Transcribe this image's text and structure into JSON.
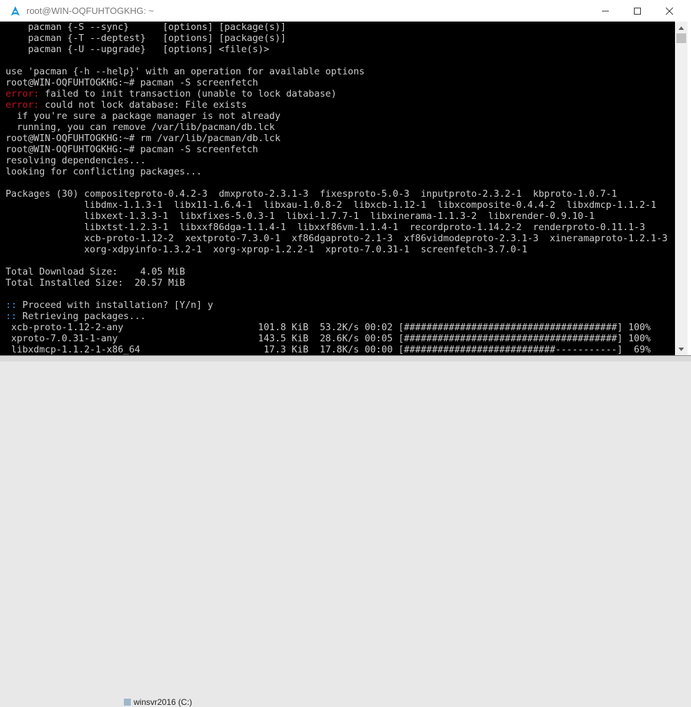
{
  "window": {
    "title": "root@WIN-OQFUHTOGKHG: ~",
    "minimize_glyph": "—",
    "maximize_glyph": "☐",
    "close_glyph": "✕"
  },
  "taskbar": {
    "explorer_item": "winsvr2016 (C:)"
  },
  "terminal": {
    "lines": [
      {
        "row": 0,
        "text": "    pacman {-S --sync}      [options] [package(s)]"
      },
      {
        "row": 1,
        "text": "    pacman {-T --deptest}   [options] [package(s)]"
      },
      {
        "row": 2,
        "text": "    pacman {-U --upgrade}   [options] <file(s)>"
      },
      {
        "row": 4,
        "text": "use 'pacman {-h --help}' with an operation for available options"
      },
      {
        "row": 5,
        "text": "root@WIN-OQFUHTOGKHG:~# pacman -S screenfetch"
      },
      {
        "row": 6,
        "prefix": "error:",
        "prefix_class": "err",
        "text": " failed to init transaction (unable to lock database)"
      },
      {
        "row": 7,
        "prefix": "error:",
        "prefix_class": "err",
        "text": " could not lock database: File exists"
      },
      {
        "row": 8,
        "text": "  if you're sure a package manager is not already"
      },
      {
        "row": 9,
        "text": "  running, you can remove /var/lib/pacman/db.lck"
      },
      {
        "row": 10,
        "text": "root@WIN-OQFUHTOGKHG:~# rm /var/lib/pacman/db.lck"
      },
      {
        "row": 11,
        "text": "root@WIN-OQFUHTOGKHG:~# pacman -S screenfetch"
      },
      {
        "row": 12,
        "text": "resolving dependencies..."
      },
      {
        "row": 13,
        "text": "looking for conflicting packages..."
      },
      {
        "row": 15,
        "text": "Packages (30) compositeproto-0.4.2-3  dmxproto-2.3.1-3  fixesproto-5.0-3  inputproto-2.3.2-1  kbproto-1.0.7-1"
      },
      {
        "row": 16,
        "text": "              libdmx-1.1.3-1  libx11-1.6.4-1  libxau-1.0.8-2  libxcb-1.12-1  libxcomposite-0.4.4-2  libxdmcp-1.1.2-1"
      },
      {
        "row": 17,
        "text": "              libxext-1.3.3-1  libxfixes-5.0.3-1  libxi-1.7.7-1  libxinerama-1.1.3-2  libxrender-0.9.10-1"
      },
      {
        "row": 18,
        "text": "              libxtst-1.2.3-1  libxxf86dga-1.1.4-1  libxxf86vm-1.1.4-1  recordproto-1.14.2-2  renderproto-0.11.1-3"
      },
      {
        "row": 19,
        "text": "              xcb-proto-1.12-2  xextproto-7.3.0-1  xf86dgaproto-2.1-3  xf86vidmodeproto-2.3.1-3  xineramaproto-1.2.1-3"
      },
      {
        "row": 20,
        "text": "              xorg-xdpyinfo-1.3.2-1  xorg-xprop-1.2.2-1  xproto-7.0.31-1  screenfetch-3.7.0-1"
      },
      {
        "row": 22,
        "text": "Total Download Size:    4.05 MiB"
      },
      {
        "row": 23,
        "text": "Total Installed Size:  20.57 MiB"
      },
      {
        "row": 25,
        "prefix": "::",
        "prefix_class": "cyan",
        "text": " Proceed with installation? [Y/n] y"
      },
      {
        "row": 26,
        "prefix": "::",
        "prefix_class": "cyan",
        "text": " Retrieving packages..."
      },
      {
        "row": 27,
        "text": " xcb-proto-1.12-2-any                        101.8 KiB  53.2K/s 00:02 [######################################] 100%"
      },
      {
        "row": 28,
        "text": " xproto-7.0.31-1-any                         143.5 KiB  28.6K/s 00:05 [######################################] 100%"
      },
      {
        "row": 29,
        "text": " libxdmcp-1.1.2-1-x86_64                      17.3 KiB  17.8K/s 00:00 [###########################-----------]  69%"
      }
    ]
  }
}
